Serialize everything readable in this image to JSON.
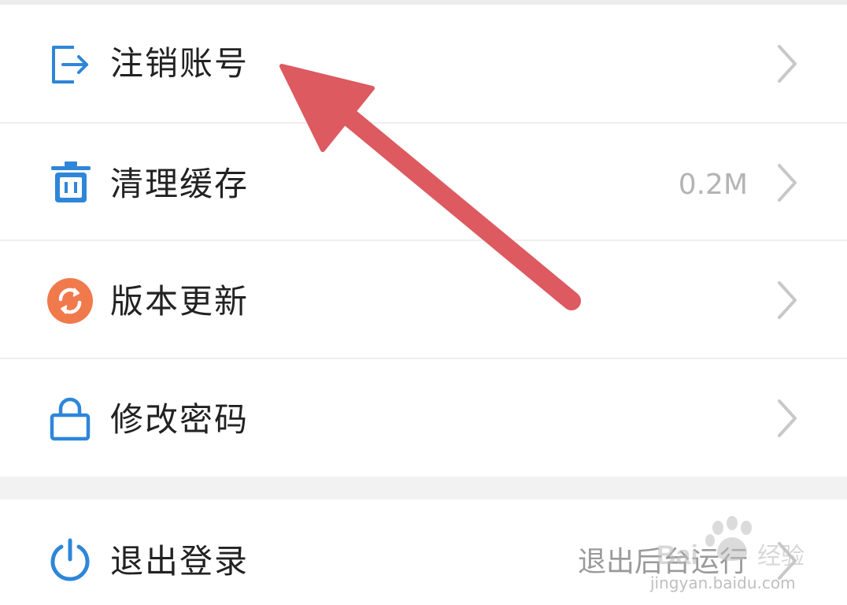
{
  "settings": {
    "items": [
      {
        "label": "注销账号",
        "icon": "logout-icon",
        "value": ""
      },
      {
        "label": "清理缓存",
        "icon": "trash-icon",
        "value": "0.2M"
      },
      {
        "label": "版本更新",
        "icon": "refresh-icon",
        "value": ""
      },
      {
        "label": "修改密码",
        "icon": "lock-icon",
        "value": ""
      }
    ],
    "logout": {
      "label": "退出登录",
      "icon": "power-icon",
      "value": "退出后台运行"
    }
  },
  "colors": {
    "icon_blue": "#2e86d9",
    "update_orange": "#f07a4c",
    "annotation_arrow": "#dc5a60",
    "chevron_gray": "#c8c8c8",
    "label_text": "#222222",
    "value_text": "#b4b4b4"
  },
  "watermark": {
    "text": "jingyan.baidu.com"
  }
}
